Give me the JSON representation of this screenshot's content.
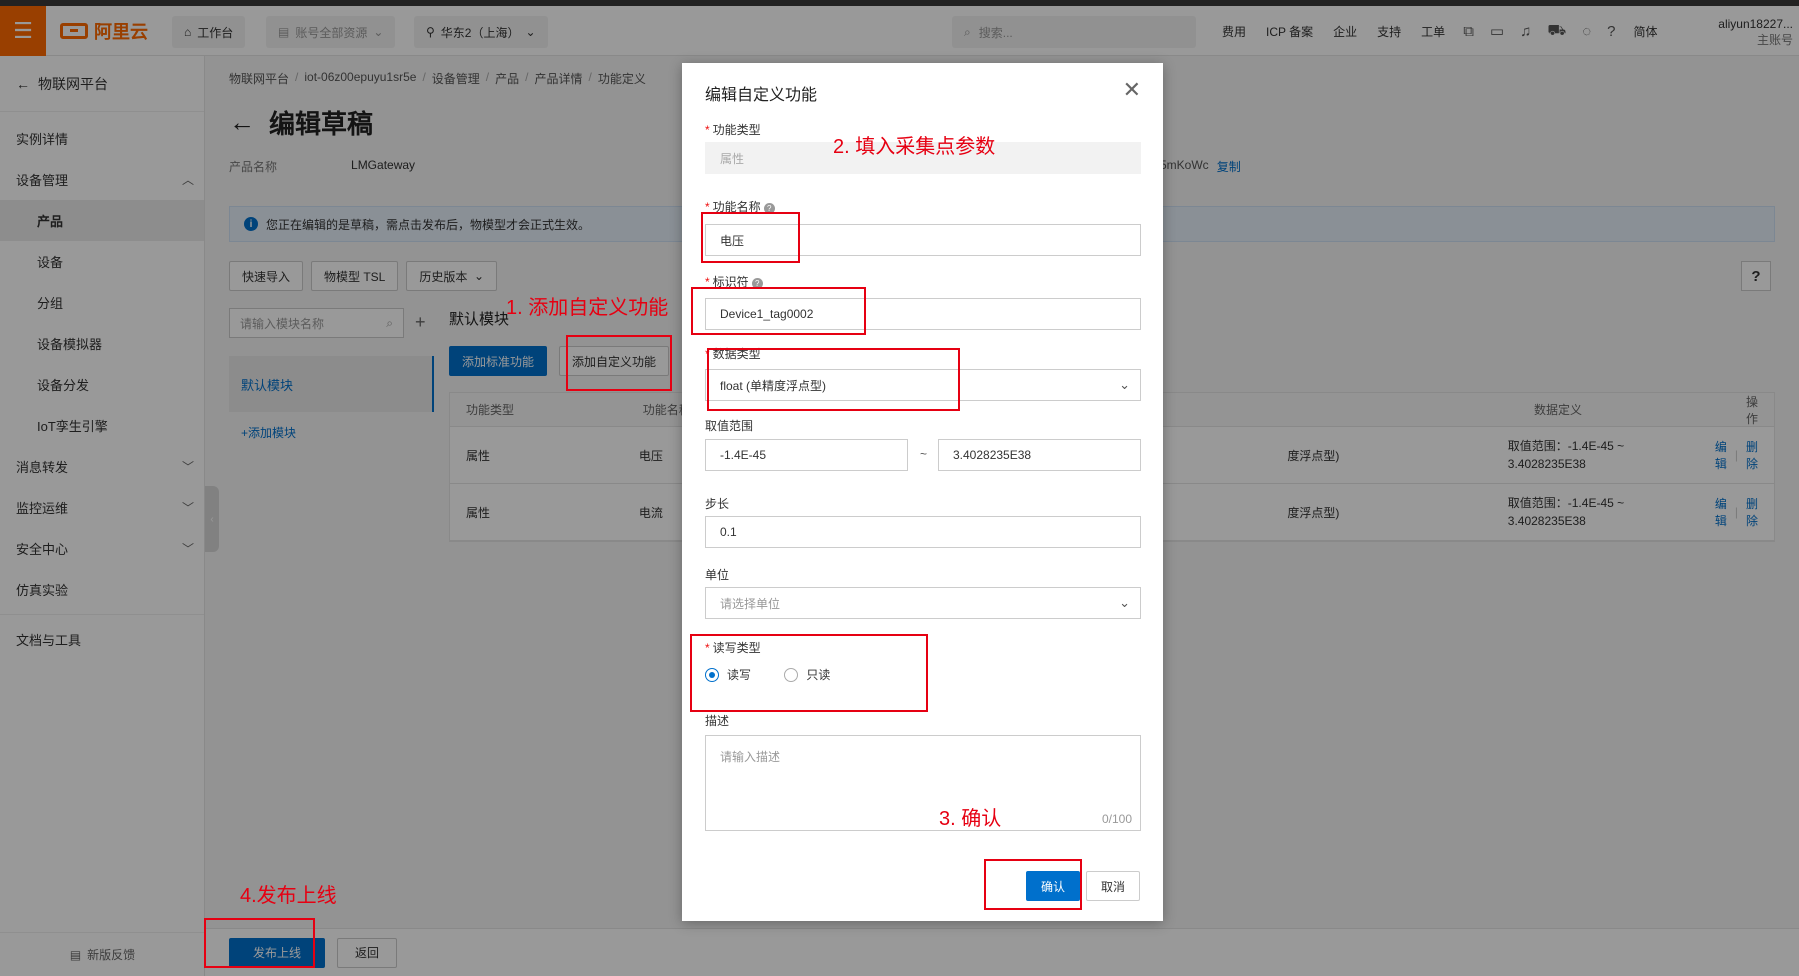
{
  "topbar": {
    "logo_text": "阿里云",
    "workbench": "工作台",
    "resources": "账号全部资源",
    "region": "华东2（上海）",
    "search_placeholder": "搜索...",
    "nav": [
      "费用",
      "ICP 备案",
      "企业",
      "支持",
      "工单"
    ],
    "lang": "简体",
    "user_name": "aliyun18227...",
    "user_sub": "主账号"
  },
  "sidebar": {
    "back_label": "物联网平台",
    "items": [
      {
        "label": "实例详情"
      },
      {
        "label": "设备管理"
      },
      {
        "label": "产品"
      },
      {
        "label": "设备"
      },
      {
        "label": "分组"
      },
      {
        "label": "设备模拟器"
      },
      {
        "label": "设备分发"
      },
      {
        "label": "IoT孪生引擎"
      },
      {
        "label": "消息转发"
      },
      {
        "label": "监控运维"
      },
      {
        "label": "安全中心"
      },
      {
        "label": "仿真实验"
      },
      {
        "label": "文档与工具"
      }
    ],
    "feedback": "新版反馈"
  },
  "page": {
    "breadcrumb": [
      "物联网平台",
      "iot-06z00epuyu1sr5e",
      "设备管理",
      "产品",
      "产品详情",
      "功能定义"
    ],
    "title": "编辑草稿",
    "product_label": "产品名称",
    "product_value": "LMGateway",
    "right_info": "5mKoWc",
    "copy_label": "复制",
    "notice": "您正在编辑的是草稿，需点击发布后，物模型才会正式生效。",
    "buttons": {
      "quick_import": "快速导入",
      "tsl": "物模型 TSL",
      "history": "历史版本"
    },
    "help": "?",
    "module_search_placeholder": "请输入模块名称",
    "module_default": "默认模块",
    "add_module": "+添加模块",
    "content_title": "默认模块",
    "add_standard": "添加标准功能",
    "add_custom": "添加自定义功能",
    "table": {
      "headers": [
        "功能类型",
        "功能名称",
        "",
        "数据定义",
        "操作"
      ],
      "rows": [
        {
          "type": "属性",
          "name": "电压",
          "dtype": "度浮点型)",
          "def": "取值范围：-1.4E-45 ~ 3.4028235E38",
          "edit": "编辑",
          "del": "删除"
        },
        {
          "type": "属性",
          "name": "电流",
          "dtype": "度浮点型)",
          "def": "取值范围：-1.4E-45 ~ 3.4028235E38",
          "edit": "编辑",
          "del": "删除"
        }
      ]
    },
    "publish": "发布上线",
    "back": "返回"
  },
  "modal": {
    "title": "编辑自定义功能",
    "func_type_label": "功能类型",
    "func_type_value": "属性",
    "func_name_label": "功能名称",
    "func_name_value": "电压",
    "identifier_label": "标识符",
    "identifier_value": "Device1_tag0002",
    "data_type_label": "数据类型",
    "data_type_value": "float (单精度浮点型)",
    "range_label": "取值范围",
    "range_min": "-1.4E-45",
    "range_sep": "~",
    "range_max": "3.4028235E38",
    "step_label": "步长",
    "step_value": "0.1",
    "unit_label": "单位",
    "unit_placeholder": "请选择单位",
    "rw_label": "读写类型",
    "rw_options": [
      "读写",
      "只读"
    ],
    "rw_selected": "读写",
    "desc_label": "描述",
    "desc_placeholder": "请输入描述",
    "desc_counter": "0/100",
    "confirm": "确认",
    "cancel": "取消"
  },
  "annotations": {
    "a1": "1. 添加自定义功能",
    "a2": "2. 填入采集点参数",
    "a3": "3. 确认",
    "a4": "4.发布上线"
  },
  "colors": {
    "brand": "#ff6a00",
    "primary": "#0070cc",
    "annotation": "#e60012"
  }
}
